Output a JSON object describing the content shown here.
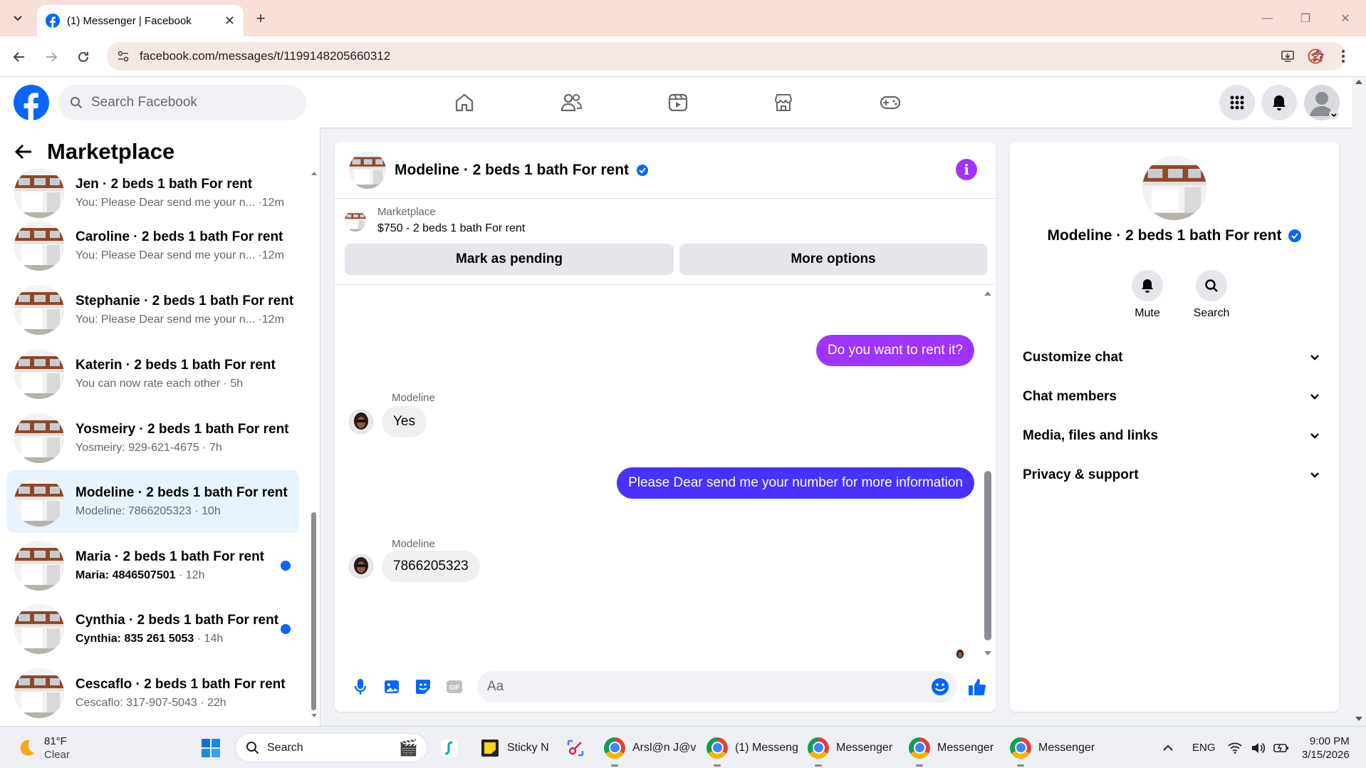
{
  "browser": {
    "tab_title": "(1) Messenger | Facebook",
    "url": "facebook.com/messages/t/1199148205660312"
  },
  "fb": {
    "search_placeholder": "Search Facebook"
  },
  "left": {
    "title": "Marketplace",
    "conversations": [
      {
        "name": "Jen · 2 beds 1 bath For rent",
        "preview": "You: Please Dear send me your n...",
        "time": " ·12m",
        "unread": false,
        "active": false
      },
      {
        "name": "Caroline · 2 beds 1 bath For rent",
        "preview": "You: Please Dear send me your n...",
        "time": " ·12m",
        "unread": false,
        "active": false
      },
      {
        "name": "Stephanie · 2 beds 1 bath For rent",
        "preview": "You: Please Dear send me your n...",
        "time": " ·12m",
        "unread": false,
        "active": false
      },
      {
        "name": "Katerin · 2 beds 1 bath For rent",
        "preview": "You can now rate each other",
        "time": " · 5h",
        "unread": false,
        "active": false
      },
      {
        "name": "Yosmeiry · 2 beds 1 bath For rent",
        "preview": "Yosmeiry: 929-621-4675",
        "time": " · 7h",
        "unread": false,
        "active": false
      },
      {
        "name": "Modeline · 2 beds 1 bath For rent",
        "preview": "Modeline: 7866205323",
        "time": " · 10h",
        "unread": false,
        "active": true
      },
      {
        "name": "Maria · 2 beds 1 bath For rent",
        "preview": "Maria: 4846507501",
        "time": " · 12h",
        "unread": true,
        "active": false
      },
      {
        "name": "Cynthia · 2 beds 1 bath For rent",
        "preview": "Cynthia: 835 261 5053",
        "time": " · 14h",
        "unread": true,
        "active": false
      },
      {
        "name": "Cescaflo · 2 beds 1 bath For rent",
        "preview": "Cescaflo: 317-907-5043",
        "time": " · 22h",
        "unread": false,
        "active": false
      }
    ]
  },
  "chat": {
    "title": "Modeline · 2 beds 1 bath For rent",
    "listing_source": "Marketplace",
    "listing_price": "$750 - 2 beds 1 bath For rent",
    "mark_pending": "Mark as pending",
    "more_options": "More options",
    "messages": [
      {
        "from": "me",
        "text": "Do you want to rent it?"
      },
      {
        "from": "Modeline",
        "sender_label": "Modeline",
        "text": "Yes"
      },
      {
        "from": "me",
        "text": "Please Dear send me your number for more information"
      },
      {
        "from": "Modeline",
        "sender_label": "Modeline",
        "text": "7866205323"
      }
    ],
    "input_placeholder": "Aa"
  },
  "right": {
    "name": "Modeline · 2 beds 1 bath For rent",
    "mute": "Mute",
    "search": "Search",
    "sections": [
      "Customize chat",
      "Chat members",
      "Media, files and links",
      "Privacy & support"
    ]
  },
  "taskbar": {
    "weather_temp": "81°F",
    "weather_cond": "Clear",
    "search": "Search",
    "apps": [
      {
        "label": "Sticky N"
      },
      {
        "label": "Arsl@n J@v"
      },
      {
        "label": "(1) Messeng"
      },
      {
        "label": "Messenger"
      },
      {
        "label": "Messenger"
      },
      {
        "label": "Messenger"
      }
    ],
    "lang": "ENG",
    "time": "9:00 PM",
    "date": "3/15/2026"
  },
  "colors": {
    "fb_blue": "#0866ff",
    "outgoing_purple": "#a033ff",
    "outgoing_blue": "#4731ff",
    "active_row": "#e7f3ff"
  }
}
